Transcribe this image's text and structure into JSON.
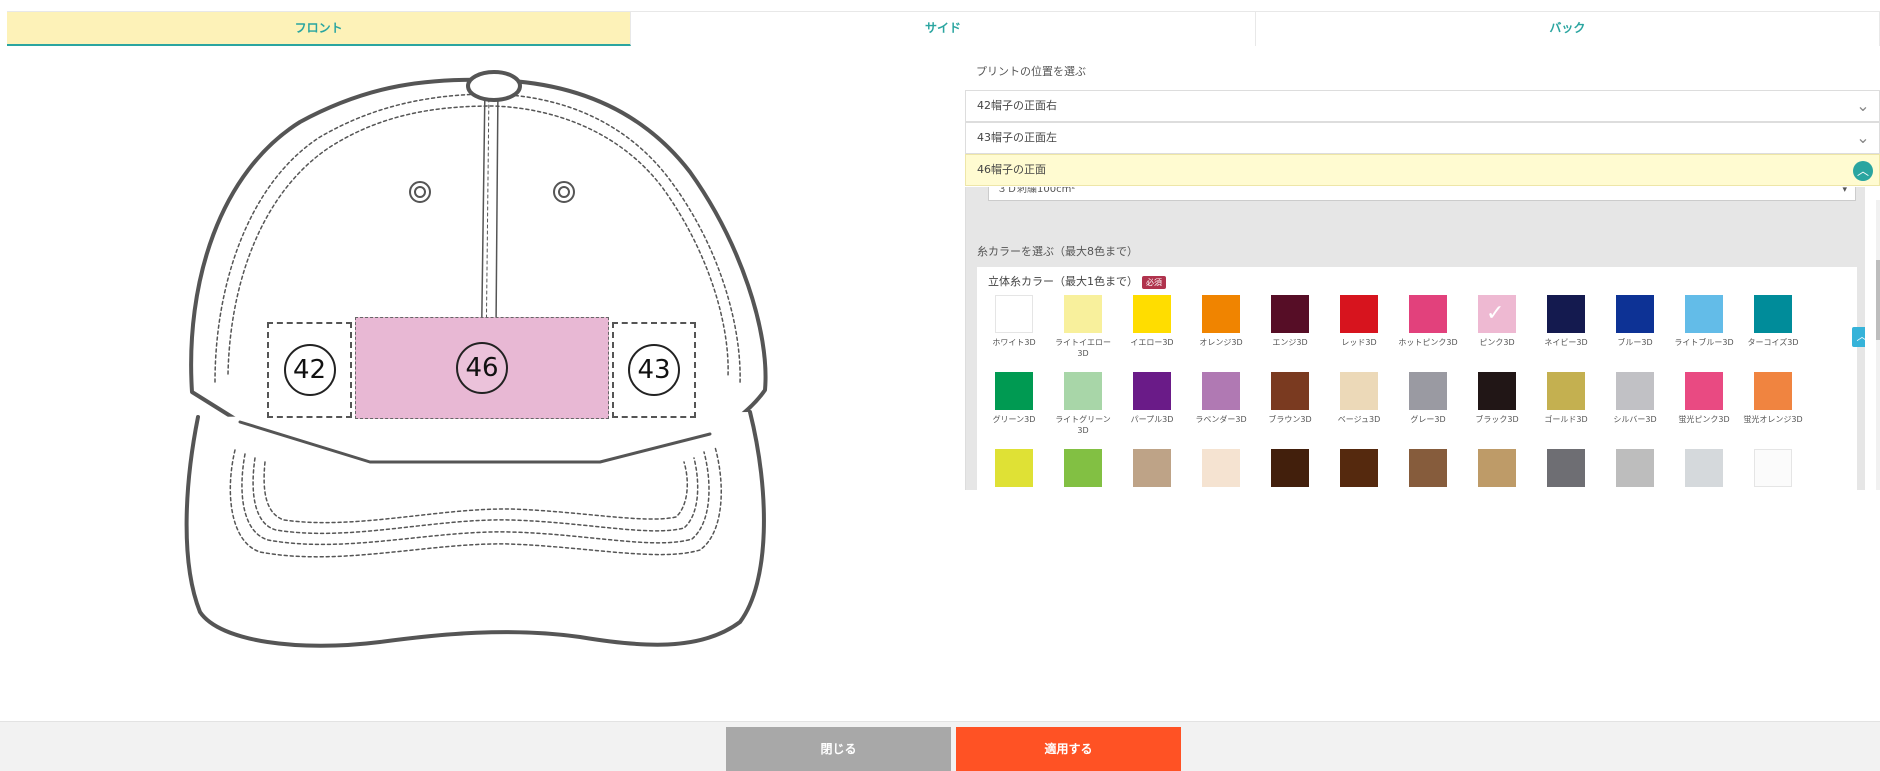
{
  "tabs": [
    {
      "label": "フロント",
      "active": true
    },
    {
      "label": "サイド",
      "active": false
    },
    {
      "label": "バック",
      "active": false
    }
  ],
  "cap": {
    "zones": [
      {
        "number": "42"
      },
      {
        "number": "46"
      },
      {
        "number": "43"
      }
    ],
    "highlight_color": "#e8b8d4"
  },
  "panel": {
    "title": "プリントの位置を選ぶ",
    "accordions": [
      {
        "label": "42帽子の正面右",
        "open": false
      },
      {
        "label": "43帽子の正面左",
        "open": false
      },
      {
        "label": "46帽子の正面",
        "open": true
      }
    ],
    "select_value": "３Ｄ刺繍100cm²",
    "thread_label": "糸カラーを選ぶ（最大8色まで）",
    "card_title": "立体糸カラー（最大1色まで）",
    "required_badge": "必須",
    "colors": [
      {
        "name": "ホワイト3D",
        "hex": "#ffffff"
      },
      {
        "name": "ライトイエロー3D",
        "hex": "#f8f09c"
      },
      {
        "name": "イエロー3D",
        "hex": "#ffdd00"
      },
      {
        "name": "オレンジ3D",
        "hex": "#f08400"
      },
      {
        "name": "エンジ3D",
        "hex": "#560d26"
      },
      {
        "name": "レッド3D",
        "hex": "#d7141e"
      },
      {
        "name": "ホットピンク3D",
        "hex": "#e2417c"
      },
      {
        "name": "ピンク3D",
        "hex": "#eeb9d2",
        "selected": true
      },
      {
        "name": "ネイビー3D",
        "hex": "#141a4f"
      },
      {
        "name": "ブルー3D",
        "hex": "#0d3295"
      },
      {
        "name": "ライトブルー3D",
        "hex": "#63bce8"
      },
      {
        "name": "ターコイズ3D",
        "hex": "#008c9a"
      },
      {
        "name": "グリーン3D",
        "hex": "#009a52"
      },
      {
        "name": "ライトグリーン3D",
        "hex": "#a8d6a8"
      },
      {
        "name": "パープル3D",
        "hex": "#6a1b88"
      },
      {
        "name": "ラベンダー3D",
        "hex": "#b079b3"
      },
      {
        "name": "ブラウン3D",
        "hex": "#7a3a20"
      },
      {
        "name": "ベージュ3D",
        "hex": "#ecd9b8"
      },
      {
        "name": "グレー3D",
        "hex": "#9a9aa2"
      },
      {
        "name": "ブラック3D",
        "hex": "#211616"
      },
      {
        "name": "ゴールド3D",
        "hex": "#c4b050"
      },
      {
        "name": "シルバー3D",
        "hex": "#c1c1c5"
      },
      {
        "name": "蛍光ピンク3D",
        "hex": "#e94a82"
      },
      {
        "name": "蛍光オレンジ3D",
        "hex": "#f08440"
      },
      {
        "name": "",
        "hex": "#dfe135"
      },
      {
        "name": "",
        "hex": "#82c043"
      },
      {
        "name": "",
        "hex": "#bea387"
      },
      {
        "name": "",
        "hex": "#f5e3d1"
      },
      {
        "name": "",
        "hex": "#421f0c"
      },
      {
        "name": "",
        "hex": "#55290e"
      },
      {
        "name": "",
        "hex": "#865c3c"
      },
      {
        "name": "",
        "hex": "#be9b68"
      },
      {
        "name": "",
        "hex": "#6e6e73"
      },
      {
        "name": "",
        "hex": "#bdbdbd"
      },
      {
        "name": "",
        "hex": "#d5d9dc"
      },
      {
        "name": "",
        "hex": "#fbfbfb"
      }
    ]
  },
  "footer": {
    "close_label": "閉じる",
    "apply_label": "適用する"
  }
}
